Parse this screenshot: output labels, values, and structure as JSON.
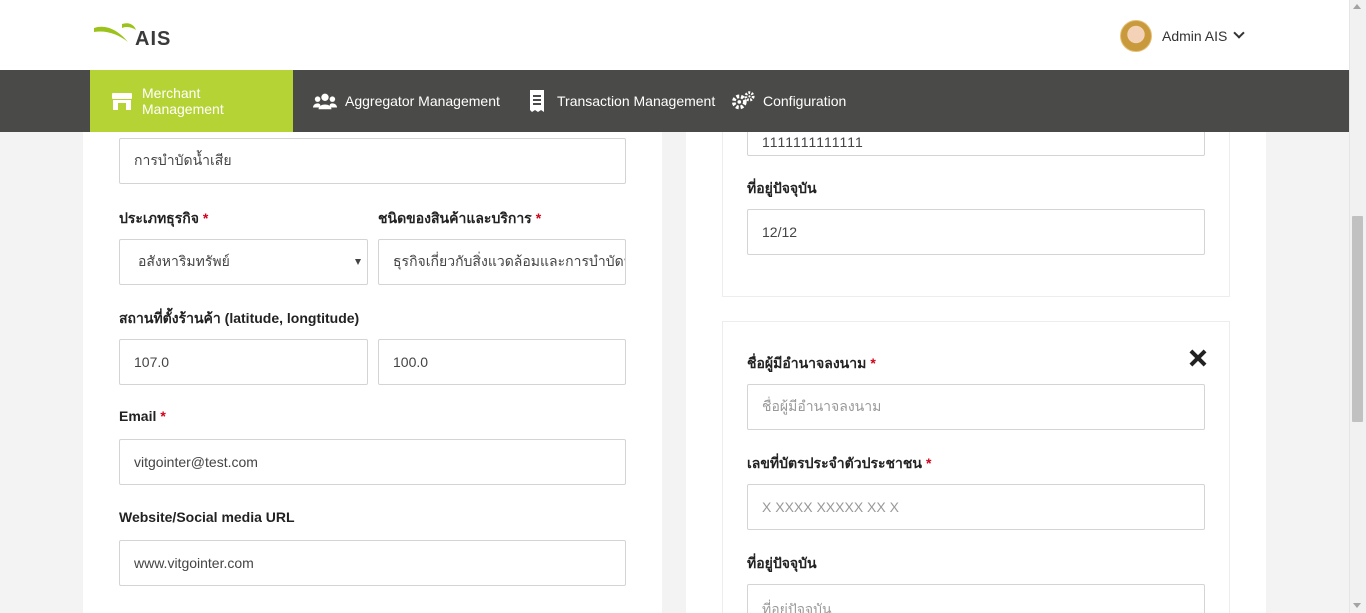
{
  "header": {
    "logo_text": "AIS",
    "user_name": "Admin AIS"
  },
  "nav": {
    "items": [
      {
        "label": "Merchant Management",
        "icon": "store-icon",
        "active": true
      },
      {
        "label": "Aggregator Management",
        "icon": "users-icon",
        "active": false
      },
      {
        "label": "Transaction Management",
        "icon": "receipt-icon",
        "active": false
      },
      {
        "label": "Configuration",
        "icon": "gears-icon",
        "active": false
      }
    ]
  },
  "left_form": {
    "top_field_value": "การบำบัดน้ำเสีย",
    "business_type": {
      "label": "ประเภทธุรกิจ",
      "required_mark": "*",
      "value": "อสังหาริมทรัพย์"
    },
    "product_type": {
      "label": "ชนิดของสินค้าและบริการ",
      "required_mark": "*",
      "value": "ธุรกิจเกี่ยวกับสิ่งแวดล้อมและการบำบัดน้ำเสีย"
    },
    "location": {
      "label": "สถานที่ตั้งร้านค้า (latitude, longtitude)",
      "latitude": "107.0",
      "longitude": "100.0"
    },
    "email": {
      "label": "Email",
      "required_mark": "*",
      "value": "vitgointer@test.com"
    },
    "website": {
      "label": "Website/Social media URL",
      "value": "www.vitgointer.com"
    }
  },
  "right_form": {
    "top_field_value": "1111111111111",
    "address_label": "ที่อยู่ปัจจุบัน",
    "address_value": "12/12",
    "signatory": {
      "name_label": "ชื่อผู้มีอำนาจลงนาม",
      "required_mark": "*",
      "name_placeholder": "ชื่อผู้มีอำนาจลงนาม",
      "id_label": "เลขที่บัตรประจำตัวประชาชน",
      "id_placeholder": "X XXXX XXXXX XX X",
      "address_label": "ที่อยู่ปัจจุบัน",
      "address_placeholder": "ที่อยู่ปัจจุบัน"
    }
  },
  "colors": {
    "accent": "#b5d334",
    "nav_bg": "#4a4a48",
    "required": "#d0021b"
  }
}
